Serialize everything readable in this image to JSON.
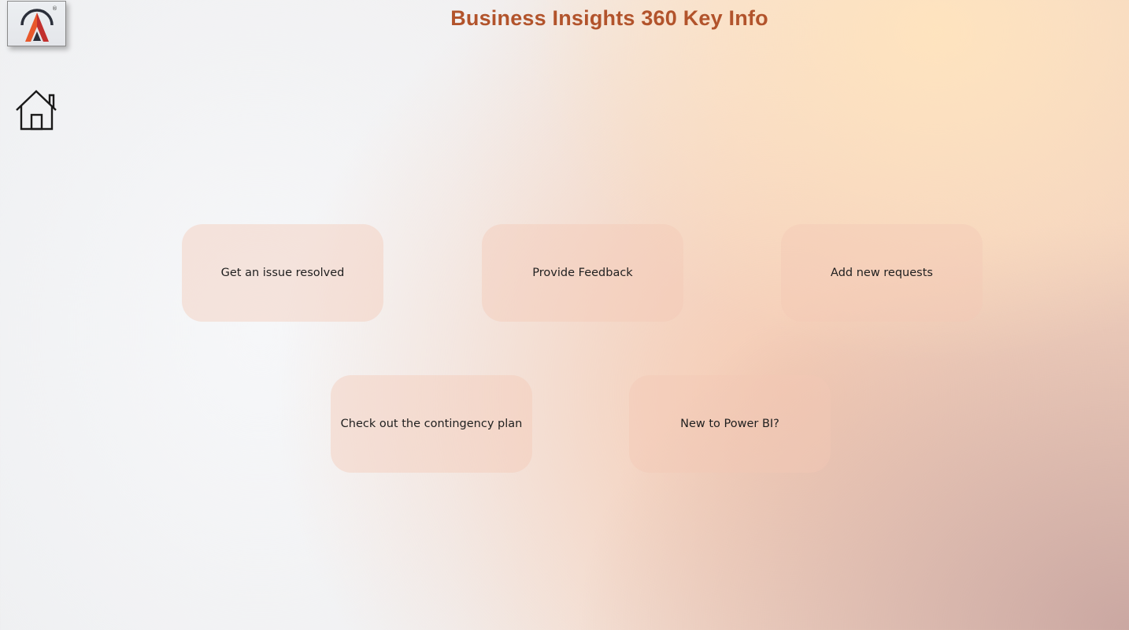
{
  "header": {
    "title": "Business Insights 360 Key Info"
  },
  "brand": {
    "logo_icon": "brand-a-logo-icon",
    "registered_mark": "®",
    "accent_colors": [
      "#e8582c",
      "#c2302e",
      "#2b2f3a"
    ]
  },
  "nav": {
    "home_icon": "home-icon"
  },
  "tiles": [
    {
      "label": "Get an issue resolved"
    },
    {
      "label": "Provide Feedback"
    },
    {
      "label": "Add new requests"
    },
    {
      "label": "Check out the contingency plan"
    },
    {
      "label": "New to Power BI?"
    }
  ],
  "colors": {
    "title": "#b2532b",
    "tile_background": "#f3c8b6"
  }
}
